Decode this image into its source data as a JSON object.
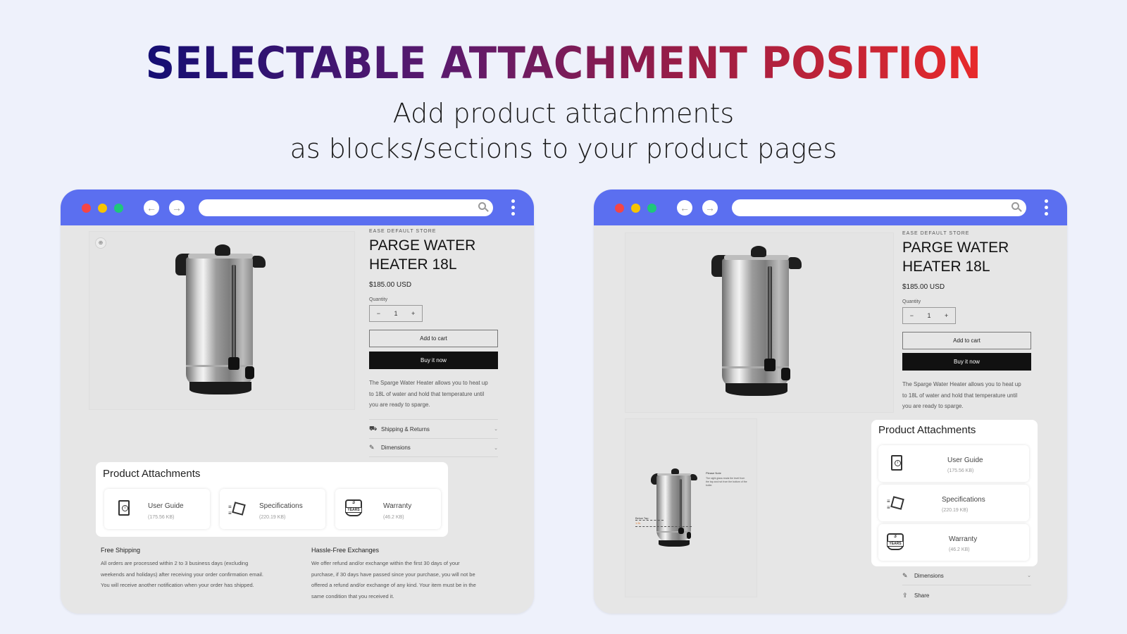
{
  "header": {
    "title": "SELECTABLE ATTACHMENT POSITION",
    "subtitle_line1": "Add product attachments",
    "subtitle_line2": "as blocks/sections to your product pages",
    "gradient_colors": [
      "#140e73",
      "#5a1a6e",
      "#9a1d45",
      "#e82a2a"
    ]
  },
  "browser": {
    "bar_color": "#5b6ff0",
    "dots": [
      "#f44545",
      "#f6c400",
      "#1ec77a"
    ],
    "back_icon": "←",
    "forward_icon": "→"
  },
  "product": {
    "vendor": "EASE DEFAULT STORE",
    "title_line1": "PARGE WATER",
    "title_line2": "HEATER 18L",
    "price": "$185.00 USD",
    "quantity_label": "Quantity",
    "quantity_value": "1",
    "minus": "−",
    "plus": "+",
    "add_to_cart": "Add to cart",
    "buy_now": "Buy it now",
    "description_lines": [
      "The Sparge Water Heater allows you to heat up",
      "to 18L of water and hold that temperature until",
      "you are ready to sparge."
    ],
    "accordions": [
      {
        "icon": "truck-icon",
        "glyph": "⛟",
        "label": "Shipping & Returns"
      },
      {
        "icon": "ruler-icon",
        "glyph": "✎",
        "label": "Dimensions"
      }
    ],
    "share_label": "Share",
    "share_glyph": "⇪",
    "chevron": "⌄"
  },
  "attachments": {
    "heading": "Product Attachments",
    "items": [
      {
        "name": "User Guide",
        "size": "(175.56 KB)"
      },
      {
        "name": "Specifications",
        "size": "(220.19 KB)"
      },
      {
        "name": "Warranty",
        "size": "(46.2 KB)",
        "badge": "YEARS"
      }
    ]
  },
  "policies": [
    {
      "title": "Free Shipping",
      "lines": [
        "All orders are processed within 2 to 3 business days (excluding",
        "weekends and holidays) after receiving your order confirmation email.",
        "You will receive another notification when your order has shipped."
      ]
    },
    {
      "title": "Hassle-Free Exchanges",
      "lines": [
        "We offer refund and/or exchange within the first 30 days of your",
        "purchase, if 30 days have passed since your purchase, you will not be",
        "offered a refund and/or exchange of any kind. Your item must be in the",
        "same condition that you received it."
      ]
    }
  ],
  "secondary_image": {
    "note_title": "Please Note",
    "note_text": "The sight glass reads the level from the tap and not from the bottom of the boiler.",
    "below_tap": "Below Tap:",
    "below_tap_value": "1.5L"
  }
}
